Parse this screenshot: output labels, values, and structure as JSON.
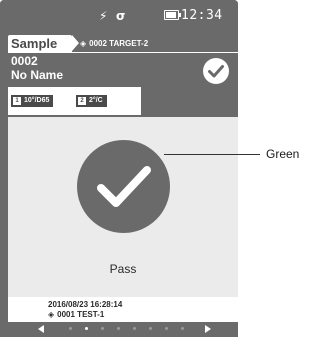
{
  "status_bar": {
    "power_icon": "lightning-icon",
    "link_icon": "sigma-icon",
    "battery_level": 1.0,
    "time": "12:34"
  },
  "header": {
    "tab_label": "Sample",
    "target_icon": "diamond-target-icon",
    "target_label": "0002 TARGET-2",
    "sample_number": "0002",
    "sample_name": "No Name",
    "judgment_icon": "check-circle-icon"
  },
  "conditions": [
    {
      "index": "1",
      "value": "10°/D65"
    },
    {
      "index": "2",
      "value": "2°/C"
    }
  ],
  "result": {
    "judgment_icon": "pass-check-icon",
    "label": "Pass"
  },
  "footer": {
    "datetime": "2016/08/23 16:28:14",
    "reference_icon": "diamond-target-icon",
    "reference": "0001 TEST-1"
  },
  "pager": {
    "page_count": 8,
    "current_page": 2
  },
  "annotation": {
    "label": "Green"
  },
  "colors": {
    "frame": "#6a6a6a",
    "panel": "#ebebeb",
    "text_dark": "#2a2a2a",
    "white": "#ffffff"
  }
}
